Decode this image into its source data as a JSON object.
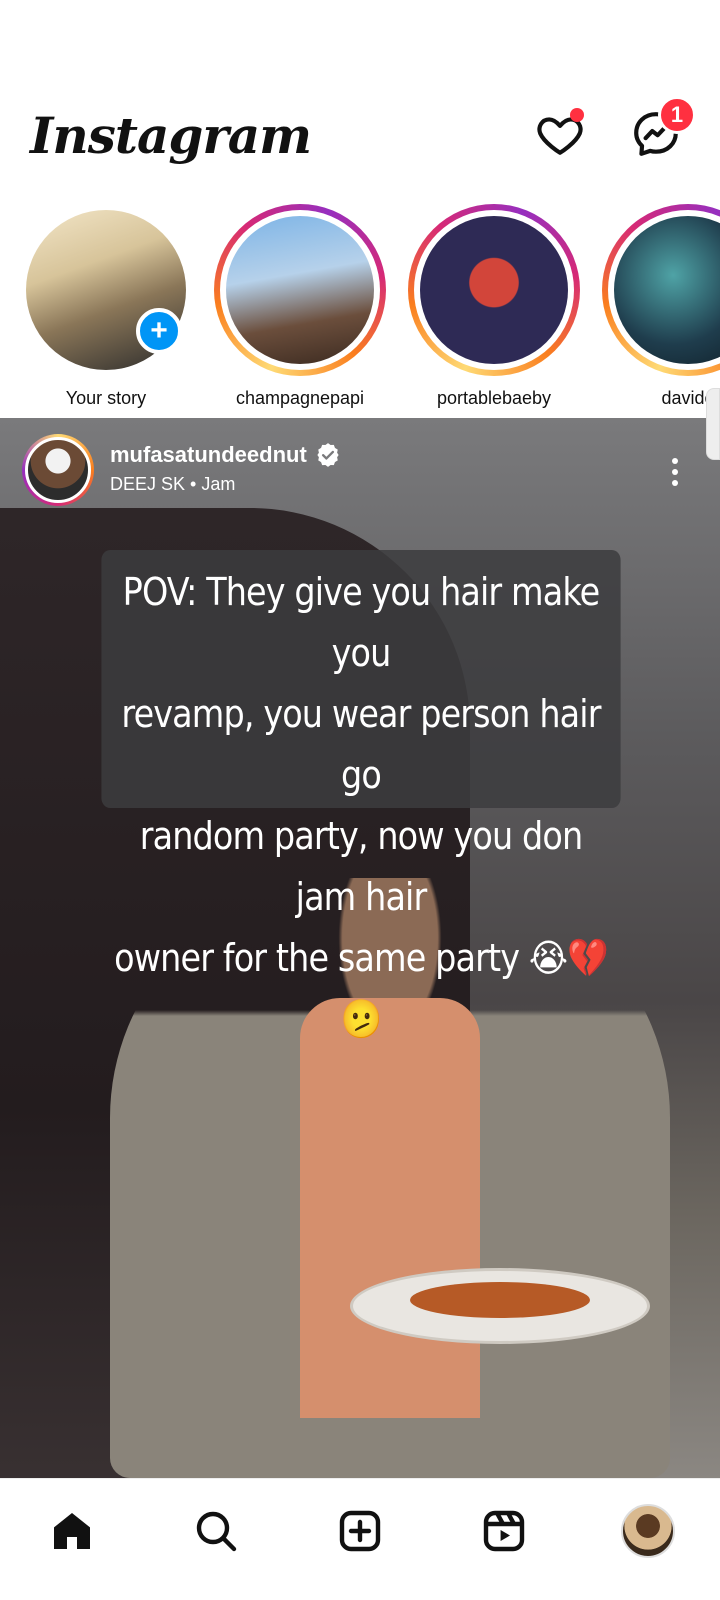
{
  "app": {
    "logo_text": "Instagram"
  },
  "header": {
    "activity_has_dot": true,
    "messages_badge": "1",
    "colors": {
      "badge": "#ff3040",
      "accent_blue": "#0095f6"
    }
  },
  "stories": [
    {
      "label": "Your story",
      "own": true
    },
    {
      "label": "champagnepapi"
    },
    {
      "label": "portablebaeby"
    },
    {
      "label": "davido"
    }
  ],
  "post": {
    "username": "mufasatundeednut",
    "verified": true,
    "subtitle": "DEEJ SK • Jam",
    "caption_lines": [
      "POV: They give you hair make you",
      "revamp, you wear person hair go",
      "random party, now you don jam hair",
      "owner for the same party 😭💔🫤"
    ]
  },
  "nav": {
    "items": [
      "home-icon",
      "search-icon",
      "create-icon",
      "reels-icon",
      "profile-avatar"
    ]
  }
}
